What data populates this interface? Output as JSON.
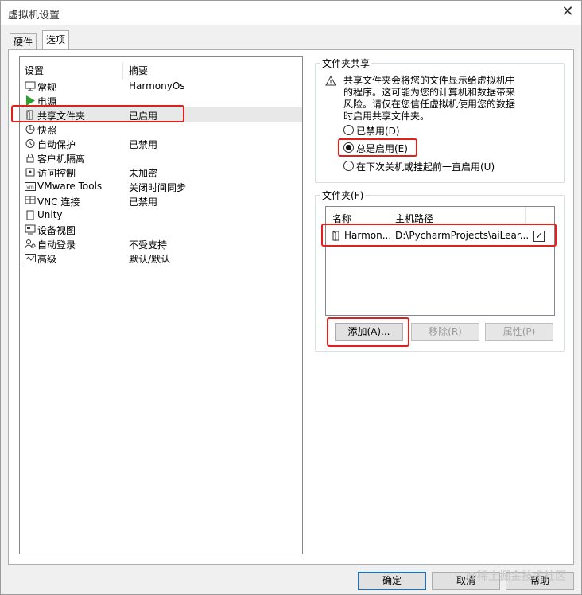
{
  "window": {
    "title": "虚拟机设置",
    "close_glyph": "✕"
  },
  "tabs": [
    {
      "label": "硬件",
      "active": false
    },
    {
      "label": "选项",
      "active": true
    }
  ],
  "list": {
    "headers": {
      "setting": "设置",
      "summary": "摘要"
    },
    "items": [
      {
        "icon": "general-icon",
        "label": "常规",
        "value": "HarmonyOs"
      },
      {
        "icon": "power-play-icon",
        "label": "电源",
        "value": ""
      },
      {
        "icon": "shared-folder-icon",
        "label": "共享文件夹",
        "value": "已启用",
        "selected": true
      },
      {
        "icon": "snapshot-icon",
        "label": "快照",
        "value": ""
      },
      {
        "icon": "autoprotect-clock-icon",
        "label": "自动保护",
        "value": "已禁用"
      },
      {
        "icon": "lock-icon",
        "label": "客户机隔离",
        "value": ""
      },
      {
        "icon": "access-control-icon",
        "label": "访问控制",
        "value": "未加密"
      },
      {
        "icon": "vmware-tools-icon",
        "label": "VMware Tools",
        "value": "关闭时间同步"
      },
      {
        "icon": "vnc-icon",
        "label": "VNC 连接",
        "value": "已禁用"
      },
      {
        "icon": "unity-icon",
        "label": "Unity",
        "value": ""
      },
      {
        "icon": "device-view-icon",
        "label": "设备视图",
        "value": ""
      },
      {
        "icon": "autologin-icon",
        "label": "自动登录",
        "value": "不受支持"
      },
      {
        "icon": "advanced-icon",
        "label": "高级",
        "value": "默认/默认"
      }
    ]
  },
  "sharing": {
    "title": "文件夹共享",
    "warning_lines": [
      "共享文件夹会将您的文件显示给虚拟机中",
      "的程序。这可能为您的计算机和数据带来",
      "风险。请仅在您信任虚拟机使用您的数据",
      "时启用共享文件夹。"
    ],
    "options": [
      {
        "label": "已禁用(D)",
        "checked": false
      },
      {
        "label": "总是启用(E)",
        "checked": true
      },
      {
        "label": "在下次关机或挂起前一直启用(U)",
        "checked": false
      }
    ]
  },
  "folders": {
    "title": "文件夹(F)",
    "headers": {
      "name": "名称",
      "path": "主机路径"
    },
    "rows": [
      {
        "name": "Harmon...",
        "path": "D:\\PycharmProjects\\aiLear...",
        "enabled_glyph": "✓"
      }
    ],
    "buttons": {
      "add": "添加(A)...",
      "remove": "移除(R)",
      "properties": "属性(P)"
    }
  },
  "footer": {
    "ok": "确定",
    "cancel": "取消",
    "help": "帮助"
  },
  "watermark": "@稀土掘金技术社区",
  "colors": {
    "highlight": "#e0201b",
    "accent": "#0078d7"
  }
}
